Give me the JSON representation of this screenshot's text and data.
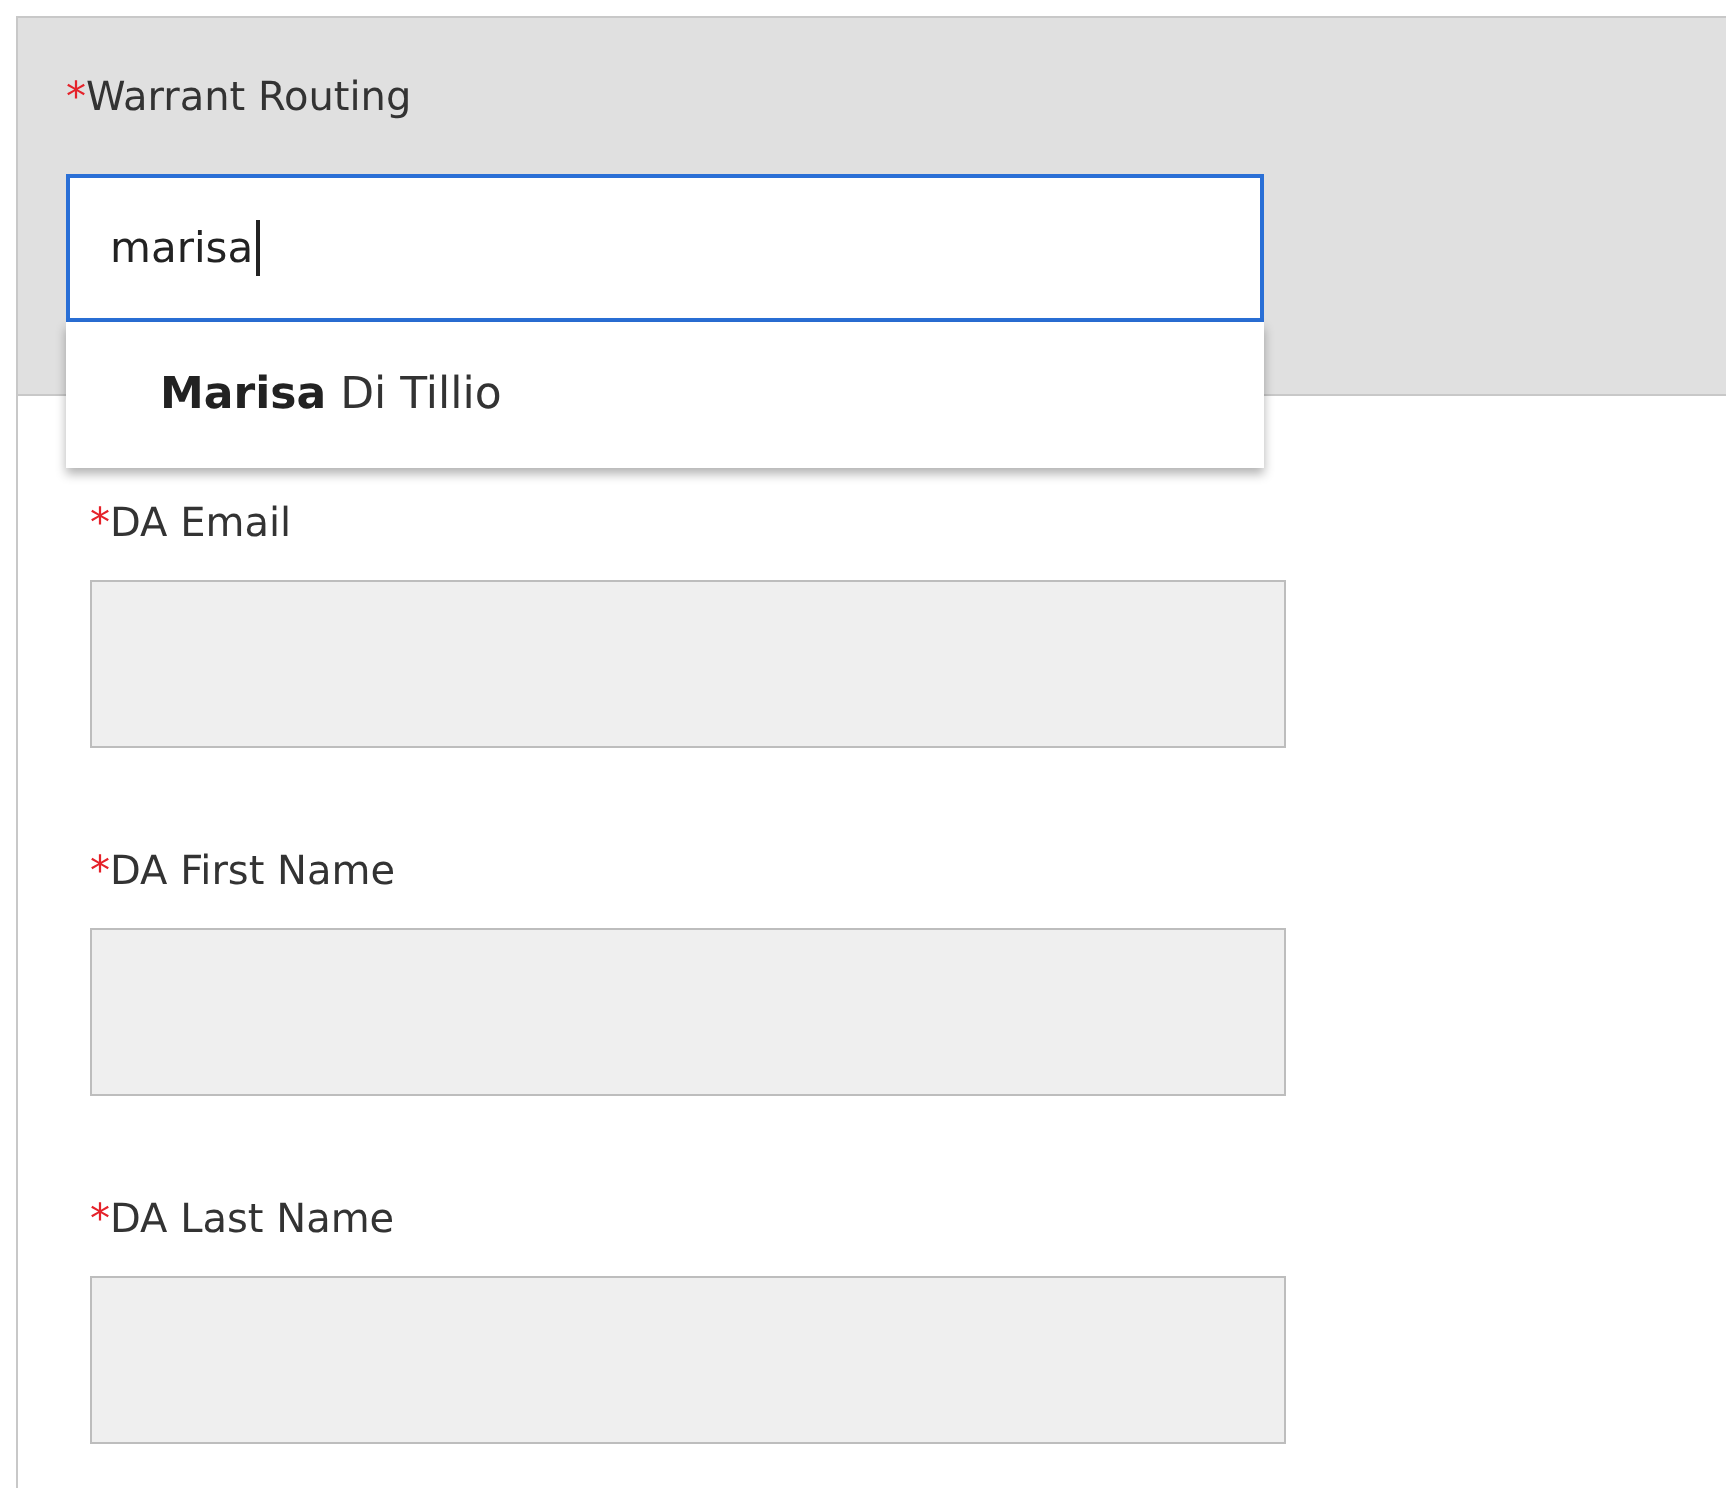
{
  "routing": {
    "required_mark": "*",
    "label": "Warrant Routing",
    "value": "marisa",
    "focused": true,
    "suggestions": [
      {
        "text": "**Marisa** Di Tillio"
      }
    ]
  },
  "fields": [
    {
      "required_mark": "*",
      "label": "DA Email",
      "disabled": true
    },
    {
      "required_mark": "*",
      "label": "DA First Name",
      "disabled": true
    },
    {
      "required_mark": "*",
      "label": "DA Last Name",
      "disabled": true
    }
  ]
}
